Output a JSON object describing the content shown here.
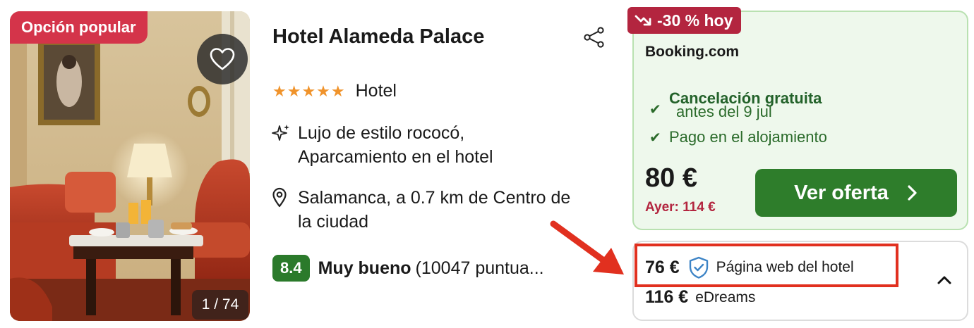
{
  "photo": {
    "badge": "Opción popular",
    "counter": "1 / 74"
  },
  "hotel": {
    "name": "Hotel Alameda Palace",
    "stars_display": "★★★★★",
    "star_rating": 5,
    "type": "Hotel",
    "features_line1": "Lujo de estilo rococó,",
    "features_line2": "Aparcamiento en el hotel",
    "location_line1": "Salamanca, a 0.7 km de Centro de",
    "location_line2": "la ciudad",
    "rating_score": "8.4",
    "rating_label": "Muy bueno",
    "rating_count": "(10047 puntua..."
  },
  "offer": {
    "deal_badge": "-30 % hoy",
    "provider": "Booking.com",
    "perk1_title": "Cancelación gratuita",
    "perk1_sub": "antes del 9 jul",
    "perk2": "Pago en el alojamiento",
    "price": "80 €",
    "previous_price": "Ayer: 114 €",
    "cta_label": "Ver oferta"
  },
  "alternatives": [
    {
      "price": "76 €",
      "name": "Página web del hotel"
    },
    {
      "price": "116 €",
      "name": "eDreams"
    }
  ],
  "colors": {
    "popular_badge": "#d4344a",
    "deal_badge": "#b3253f",
    "cta": "#2e7d2b",
    "offer_bg": "#eef8ec",
    "rating_chip": "#2b7a2b",
    "stars": "#f0932b",
    "highlight": "#e1301f"
  },
  "icons": [
    "heart-icon",
    "share-icon",
    "sparkle-icon",
    "location-pin-icon",
    "trend-down-icon",
    "check-icon",
    "chevron-right-icon",
    "verified-shield-icon",
    "chevron-up-icon",
    "arrow-annotation"
  ]
}
